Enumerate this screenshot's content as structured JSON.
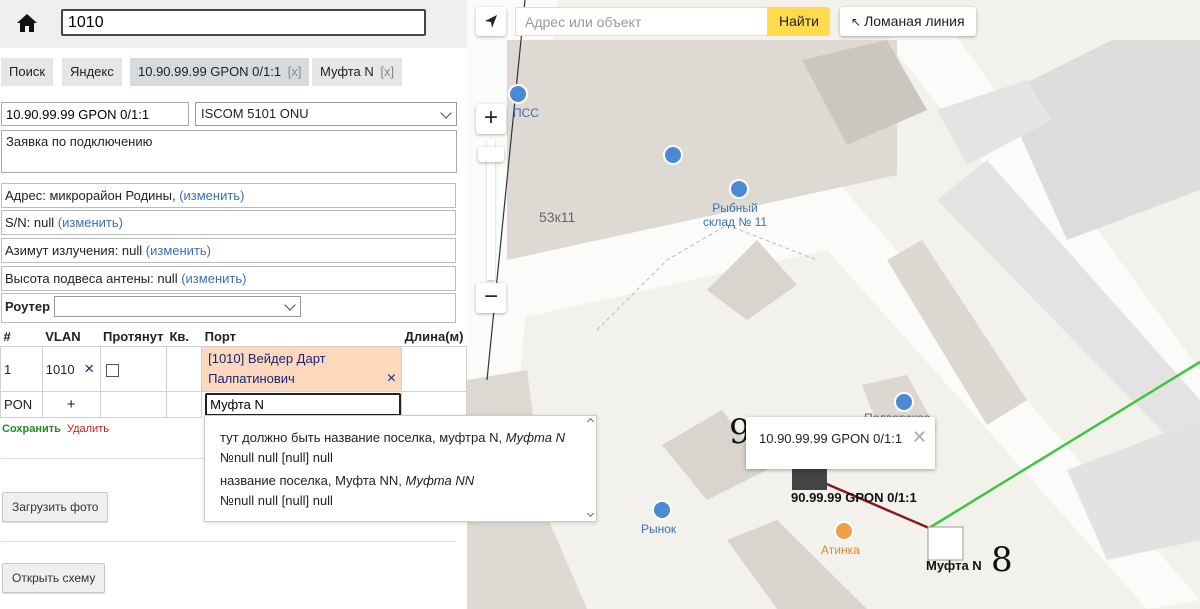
{
  "search": {
    "value": "1010"
  },
  "tabs": [
    {
      "label": "Поиск"
    },
    {
      "label": "Яндекс"
    },
    {
      "label": "10.90.99.99 GPON 0/1:1",
      "close": "[x]"
    },
    {
      "label": "Муфта N",
      "close": "[x]"
    }
  ],
  "device": {
    "name_value": "10.90.99.99 GPON 0/1:1",
    "model_selected": "ISCOM 5101 ONU",
    "request_text": "Заявка по подключению"
  },
  "info": {
    "address_label": "Адрес: микрорайон Родины,",
    "sn_label": "S/N: null",
    "azimuth_label": "Азимут излучения: null",
    "height_label": "Высота подвеса антены: null",
    "change_link": "(изменить)"
  },
  "router": {
    "label": "Роутер",
    "selected": ""
  },
  "ports_table": {
    "headers": [
      "#",
      "VLAN",
      "Протянут",
      "Кв.",
      "Порт",
      "Длина(м)"
    ],
    "row1": {
      "num": "1",
      "vlan": "1010",
      "vlan_remove": "×",
      "port": "[1010] Вейдер Дарт Палпатинович",
      "port_remove": "×"
    },
    "row2": {
      "num": "PON",
      "add": "+",
      "port_input": "Муфта N"
    }
  },
  "actions": {
    "save": "Сохранить",
    "delete": "Удалить",
    "upload_photo": "Загрузить фото",
    "open_scheme": "Открыть схему"
  },
  "suggestions": [
    {
      "line1_text": "тут должно быть название поселка, муфтра N, ",
      "line1_italic": "Муфта N",
      "line2": "№null null [null] null"
    },
    {
      "line1_text": "название поселка, Муфта NN, ",
      "line1_italic": "Муфта NN",
      "line2": "№null null [null] null"
    }
  ],
  "map": {
    "search_placeholder": "Адрес или объект",
    "find_button": "Найти",
    "polyline_button": "Ломаная линия",
    "zoom_in": "+",
    "zoom_out": "−",
    "labels": {
      "shop1": "ПСС",
      "building": "53к11",
      "fish": "Рыбный\nсклад № 11",
      "market": "Рынок",
      "atinka": "Атинка",
      "shop2": "Подворское"
    },
    "popup_text": "10.90.99.99 GPON 0/1:1",
    "object_label": "90.99.99 GPON 0/1:1",
    "mufta_label": "Муфта N",
    "num9": "9",
    "num8": "8",
    "colors": {
      "green_line": "#3cc73c",
      "dark_red_line": "#8b1a1a",
      "find_yellow": "#ffdb4d"
    }
  }
}
